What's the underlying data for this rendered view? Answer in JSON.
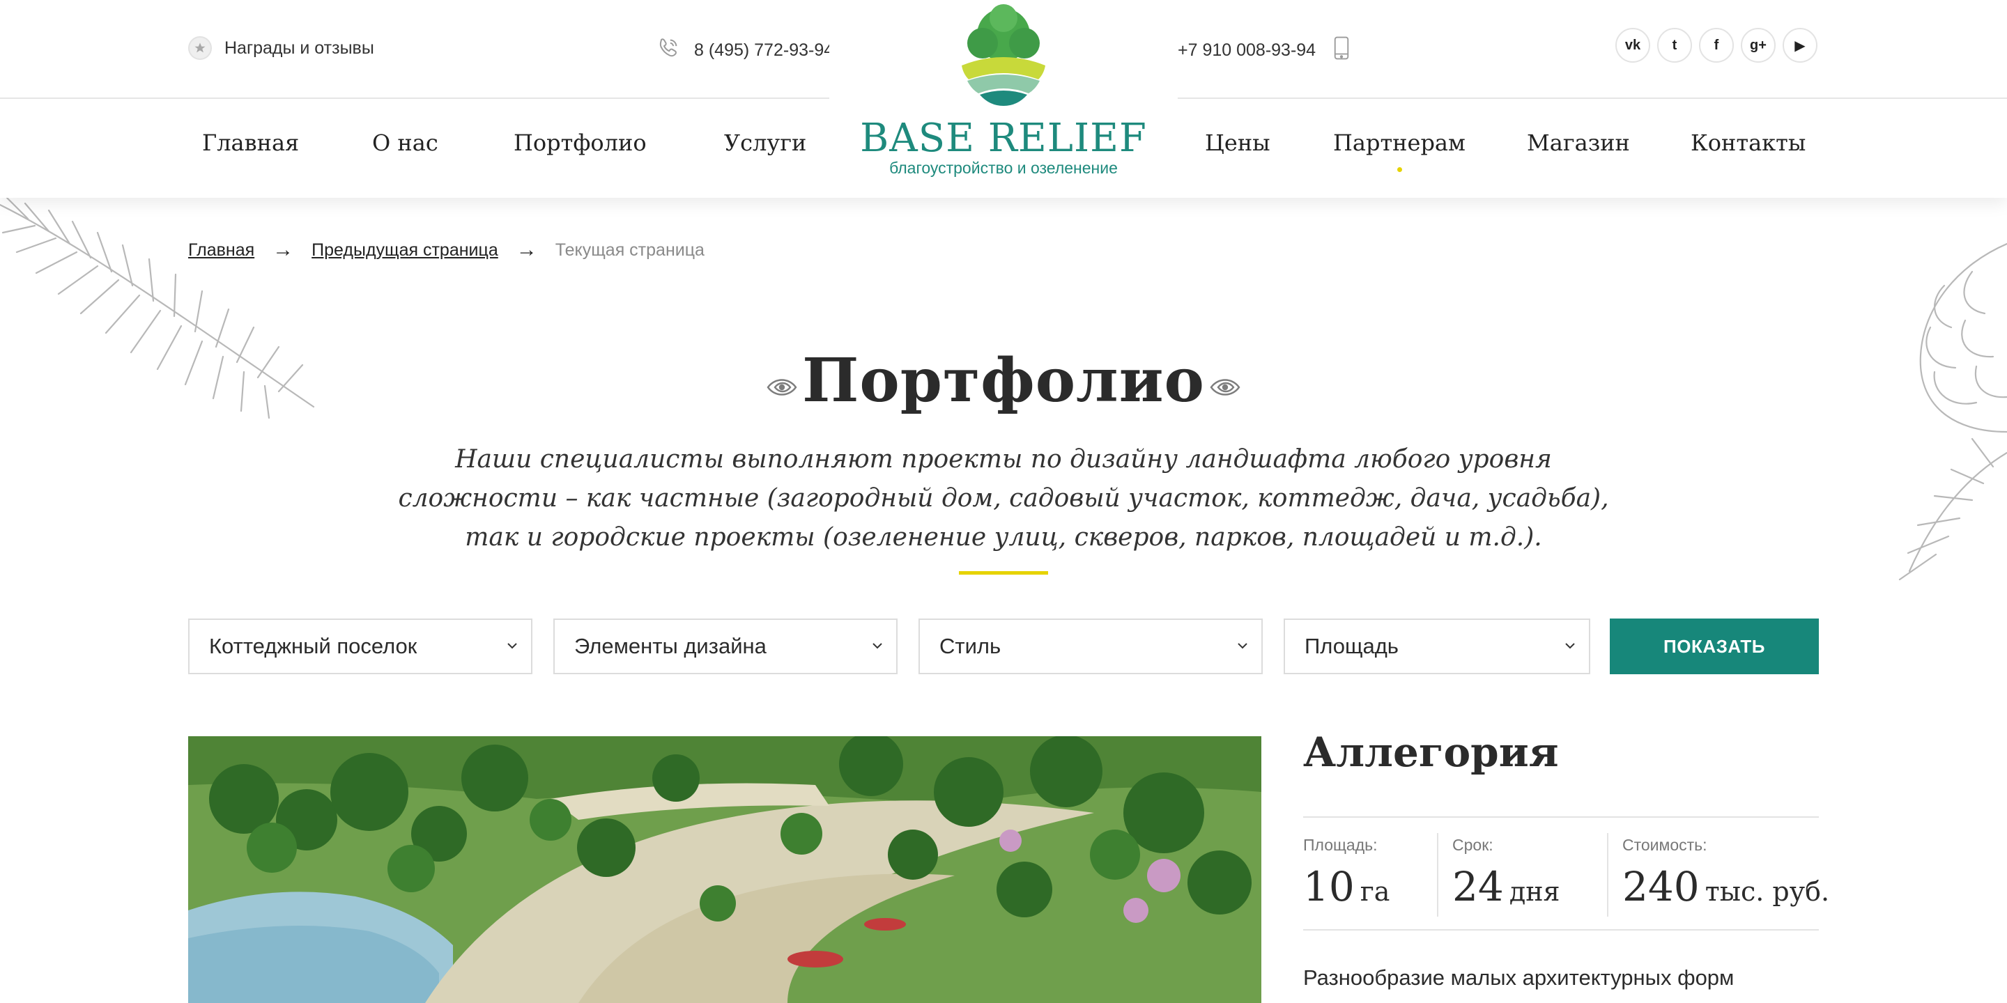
{
  "topbar": {
    "awards_label": "Награды и отзывы",
    "phone_main": "8 (495) 772-93-94",
    "phone_mobile": "+7 910 008-93-94",
    "social": [
      {
        "icon": "vk-icon",
        "glyph": "vk"
      },
      {
        "icon": "twitter-icon",
        "glyph": "t"
      },
      {
        "icon": "facebook-icon",
        "glyph": "f"
      },
      {
        "icon": "google-plus-icon",
        "glyph": "g+"
      },
      {
        "icon": "youtube-icon",
        "glyph": "▶"
      }
    ]
  },
  "logo": {
    "title": "BASE RELIEF",
    "subtitle": "благоустройство и озеленение"
  },
  "nav": {
    "items": [
      {
        "label": "Главная"
      },
      {
        "label": "О нас"
      },
      {
        "label": "Портфолио"
      },
      {
        "label": "Услуги"
      },
      {
        "label": "Цены"
      },
      {
        "label": "Партнерам",
        "marked": true
      },
      {
        "label": "Магазин"
      },
      {
        "label": "Контакты"
      }
    ]
  },
  "breadcrumb": {
    "home": "Главная",
    "previous": "Предыдущая страница",
    "current": "Текущая страница",
    "separator": "→"
  },
  "page": {
    "title": "Портфолио",
    "intro": "Наши специалисты выполняют проекты по дизайну ландшафта любого уровня сложности – как частные (загородный дом, садовый участок, коттедж, дача, усадьба), так и городские проекты (озеленение улиц, скверов, парков, площадей и т.д.)."
  },
  "filters": {
    "object_type": "Коттеджный поселок",
    "design_elements": "Элементы дизайна",
    "style": "Стиль",
    "area": "Площадь",
    "submit_label": "ПОКАЗАТЬ"
  },
  "project": {
    "title": "Аллегория",
    "area_label": "Площадь:",
    "area_value": "10",
    "area_unit": "га",
    "term_label": "Срок:",
    "term_value": "24",
    "term_unit": "дня",
    "cost_label": "Стоимость:",
    "cost_value": "240",
    "cost_unit": "тыс. руб.",
    "description": "Разнообразие малых архитектурных форм"
  },
  "colors": {
    "brand_teal": "#17877a",
    "accent_yellow": "#e6d300",
    "text_dark": "#2b2b2b"
  }
}
